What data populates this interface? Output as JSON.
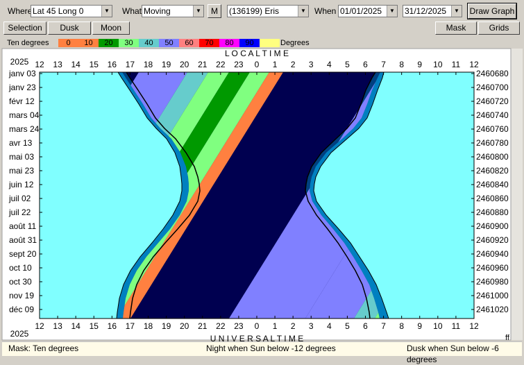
{
  "toolbar": {
    "where_label": "Where",
    "where_value": "Lat 45 Long 0",
    "what_label": "What",
    "what_value": "Moving",
    "m_button": "M",
    "object_value": "(136199) Eris",
    "when_label": "When",
    "start_date": "01/01/2025",
    "end_date": "31/12/2025",
    "draw_button": "Draw Graph"
  },
  "toolbar2": {
    "selection": "Selection",
    "dusk": "Dusk",
    "moon": "Moon",
    "mask": "Mask",
    "grids": "Grids"
  },
  "legend": {
    "title": "Ten degrees",
    "units": "Degrees",
    "items": [
      {
        "label": "0",
        "color": "#ff8040"
      },
      {
        "label": "10",
        "color": "#ff8040"
      },
      {
        "label": "20",
        "color": "#009900"
      },
      {
        "label": "30",
        "color": "#80ff80"
      },
      {
        "label": "40",
        "color": "#66cccc"
      },
      {
        "label": "50",
        "color": "#8080ff"
      },
      {
        "label": "60",
        "color": "#ff8080"
      },
      {
        "label": "70",
        "color": "#ff0000"
      },
      {
        "label": "80",
        "color": "#ff00ff"
      },
      {
        "label": "90",
        "color": "#0000ff"
      },
      {
        "label": "",
        "color": "#ffff80"
      }
    ]
  },
  "chart_data": {
    "type": "heatmap",
    "top_axis_title": "L O C A L     T I M E",
    "bottom_axis_title": "U N I V E R S A L     T I M E",
    "year_top": "2025",
    "year_bottom": "2025",
    "hour_ticks": [
      "12",
      "13",
      "14",
      "15",
      "16",
      "17",
      "18",
      "19",
      "20",
      "21",
      "22",
      "23",
      "0",
      "1",
      "2",
      "3",
      "4",
      "5",
      "6",
      "7",
      "8",
      "9",
      "10",
      "11",
      "12"
    ],
    "date_ticks": [
      "janv 03",
      "janv 23",
      "févr 12",
      "mars 04",
      "mars 24",
      "avr 13",
      "mai 03",
      "mai 23",
      "juin 12",
      "juil 02",
      "juil 22",
      "août 11",
      "août 31",
      "sept 20",
      "oct 10",
      "oct 30",
      "nov 19",
      "déc 09"
    ],
    "jd_ticks": [
      "2460680",
      "2460700",
      "2460720",
      "2460740",
      "2460760",
      "2460780",
      "2460800",
      "2460820",
      "2460840",
      "2460860",
      "2460880",
      "2460900",
      "2460920",
      "2460940",
      "2460960",
      "2460980",
      "2461000",
      "2461020"
    ],
    "corner_label": "ff",
    "colors": {
      "day": "#80ffff",
      "twilight_outer": "#0080c0",
      "twilight_inner": "#004080",
      "night": "#000050",
      "orange": "#ff8040",
      "green": "#009900",
      "light_green": "#80ff80",
      "teal": "#66cccc",
      "periwinkle": "#8080ff"
    }
  },
  "status": {
    "mask": "Mask:  Ten degrees",
    "night": "Night when Sun below -12 degrees",
    "dusk": "Dusk when Sun below -6 degrees"
  }
}
